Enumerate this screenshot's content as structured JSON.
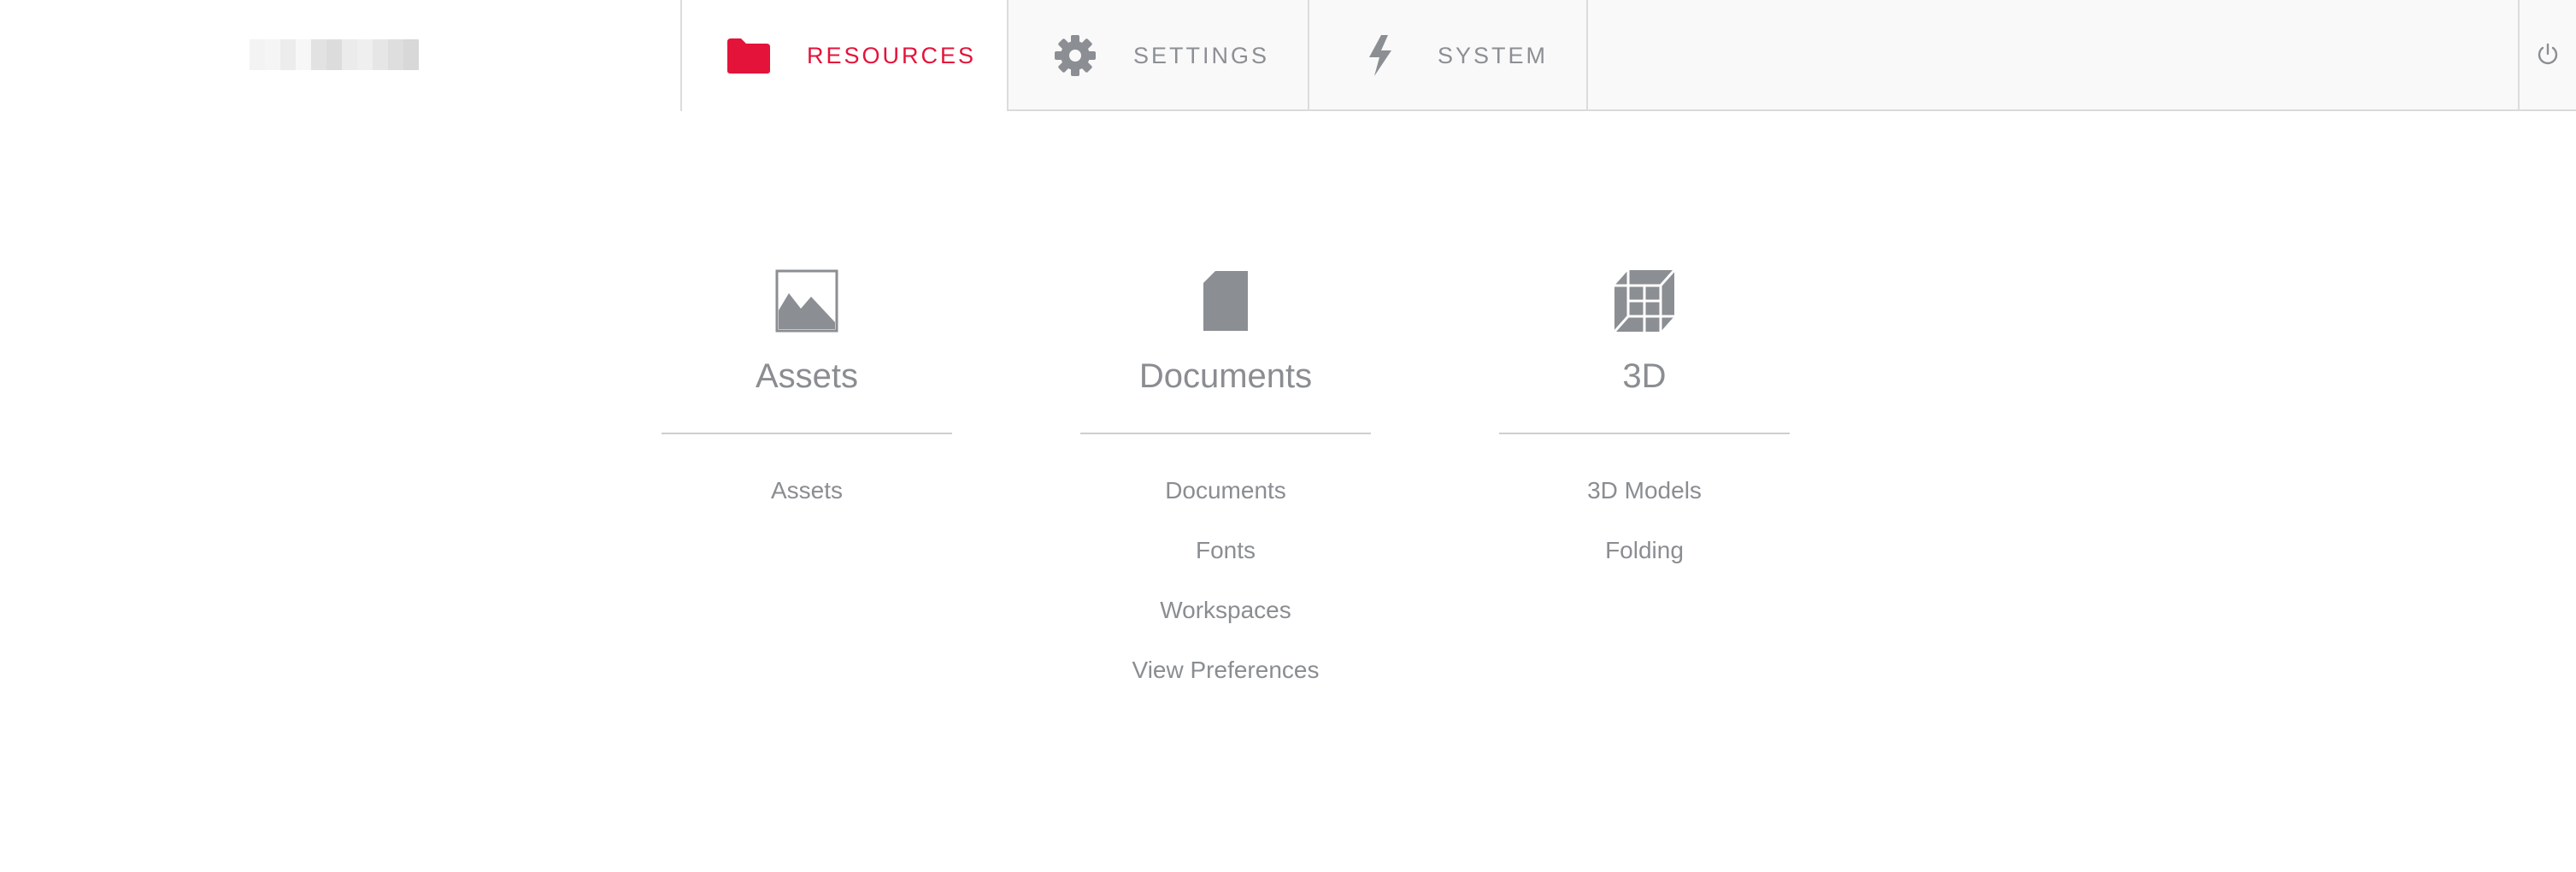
{
  "nav": {
    "tabs": [
      {
        "label": "RESOURCES",
        "icon": "folder-icon",
        "active": true
      },
      {
        "label": "SETTINGS",
        "icon": "gear-icon",
        "active": false
      },
      {
        "label": "SYSTEM",
        "icon": "lightning-icon",
        "active": false
      }
    ],
    "power_icon": "power-icon"
  },
  "sections": [
    {
      "title": "Assets",
      "icon": "image-icon",
      "links": [
        "Assets"
      ]
    },
    {
      "title": "Documents",
      "icon": "document-icon",
      "links": [
        "Documents",
        "Fonts",
        "Workspaces",
        "View Preferences"
      ]
    },
    {
      "title": "3D",
      "icon": "cube-icon",
      "links": [
        "3D Models",
        "Folding"
      ]
    }
  ],
  "colors": {
    "accent": "#e4133a",
    "text_muted": "#8a8d91",
    "icon_gray": "#8b8e92",
    "topbar_bg": "#f9f9f9"
  }
}
